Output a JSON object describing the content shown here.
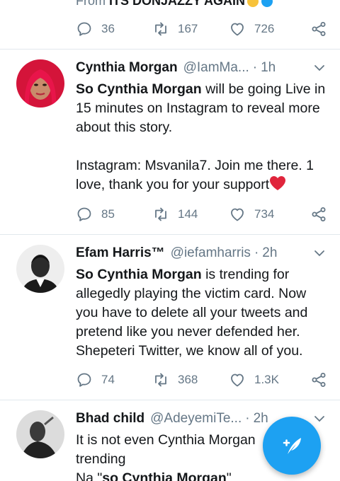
{
  "top_tweet": {
    "quote_prefix": "From",
    "quote_source": "ITS DONJAZZY AGAIN",
    "stats": {
      "replies": "36",
      "retweets": "167",
      "likes": "726"
    }
  },
  "tweets": [
    {
      "name": "Cynthia Morgan",
      "handle": "@IamMa...",
      "dot": "·",
      "time": "1h",
      "body_bold": "So Cynthia Morgan",
      "body_rest": " will be going Live in 15 minutes on Instagram to reveal more about this story.",
      "body_p2": "Instagram: Msvanila7. Join me there. 1 love, thank you for your support",
      "stats": {
        "replies": "85",
        "retweets": "144",
        "likes": "734"
      }
    },
    {
      "name": "Efam Harris™",
      "handle": "@iefamharris",
      "dot": "·",
      "time": "2h",
      "body_bold": "So Cynthia Morgan",
      "body_rest": " is trending for allegedly playing the victim card. Now you have to delete all your tweets and pretend like you never defended her. Shepeteri Twitter, we know all of you.",
      "stats": {
        "replies": "74",
        "retweets": "368",
        "likes": "1.3K"
      }
    },
    {
      "name": "Bhad child",
      "handle": "@AdeyemiTe...",
      "dot": "·",
      "time": "2h",
      "body_line1": "It is not even Cynthia Morgan",
      "body_line2": "trending",
      "body_line3_pre": "Na \"",
      "body_line3_bold": "so Cynthia Morgan",
      "body_line3_post": "\""
    }
  ],
  "fab": {
    "icon": "compose-feather-icon"
  },
  "colors": {
    "accent": "#1da1f2",
    "muted": "#657786",
    "text": "#14171a",
    "divider": "#e1e8ed"
  }
}
